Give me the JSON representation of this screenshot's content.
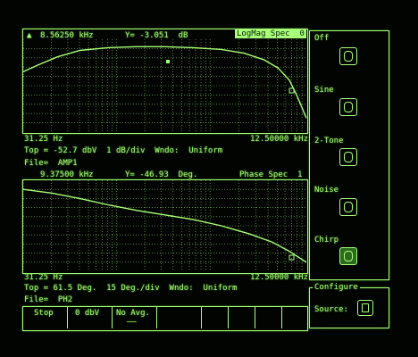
{
  "top_plot": {
    "cursor_freq": "8.56250 kHz",
    "cursor_y": "Y= -3.051  dB",
    "meas_title": "LogMag Spec  0",
    "x_start": "31.25 Hz",
    "x_end": "12.50000 kHz",
    "scale_line": "Top = -52.7 dbV  1 dB/div  Wndo:  Uniform",
    "file_line": "File=  AMP1",
    "trace_points": [
      [
        0.0,
        0.35
      ],
      [
        0.05,
        0.28
      ],
      [
        0.12,
        0.19
      ],
      [
        0.2,
        0.12
      ],
      [
        0.3,
        0.09
      ],
      [
        0.4,
        0.08
      ],
      [
        0.5,
        0.08
      ],
      [
        0.6,
        0.09
      ],
      [
        0.7,
        0.11
      ],
      [
        0.78,
        0.15
      ],
      [
        0.85,
        0.22
      ],
      [
        0.9,
        0.31
      ],
      [
        0.94,
        0.44
      ],
      [
        0.97,
        0.63
      ],
      [
        1.0,
        0.85
      ]
    ]
  },
  "bottom_plot": {
    "cursor_freq": "9.37500 kHz",
    "cursor_y": "Y= -46.93  Deg.",
    "meas_title": "Phase Spec  1",
    "x_start": "31.25 Hz",
    "x_end": "12.50000 kHz",
    "scale_line": "Top = 61.5 Deg.  15 Deg./div  Wndo:  Uniform",
    "file_line": "File=  PH2",
    "trace_points": [
      [
        0.0,
        0.1
      ],
      [
        0.1,
        0.14
      ],
      [
        0.2,
        0.2
      ],
      [
        0.3,
        0.27
      ],
      [
        0.4,
        0.33
      ],
      [
        0.5,
        0.38
      ],
      [
        0.6,
        0.43
      ],
      [
        0.7,
        0.5
      ],
      [
        0.8,
        0.59
      ],
      [
        0.88,
        0.68
      ],
      [
        0.94,
        0.78
      ],
      [
        1.0,
        0.9
      ]
    ]
  },
  "source_menu": {
    "items": [
      "Off",
      "Sine",
      "2-Tone",
      "Noise",
      "Chirp"
    ],
    "active": "Chirp"
  },
  "configure": {
    "title": "Configure",
    "source_label": "Source:"
  },
  "function_keys": [
    "Stop",
    "0 dbV",
    "No Avg.",
    "",
    "",
    "",
    "",
    ""
  ],
  "colors": {
    "phosphor": "#a8ff78",
    "background": "#000000"
  }
}
